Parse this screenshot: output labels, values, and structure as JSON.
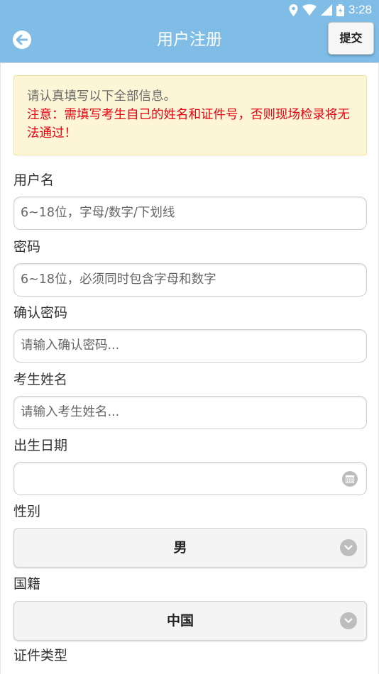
{
  "status_bar": {
    "time": "3:28"
  },
  "header": {
    "title": "用户注册",
    "submit_label": "提交"
  },
  "notice": {
    "line1": "请认真填写以下全部信息。",
    "line2": "注意：需填写考生自己的姓名和证件号，否则现场检录将无法通过！"
  },
  "form": {
    "username": {
      "label": "用户名",
      "placeholder": "6~18位，字母/数字/下划线"
    },
    "password": {
      "label": "密码",
      "placeholder": "6~18位，必须同时包含字母和数字"
    },
    "confirm_password": {
      "label": "确认密码",
      "placeholder": "请输入确认密码..."
    },
    "student_name": {
      "label": "考生姓名",
      "placeholder": "请输入考生姓名..."
    },
    "birth_date": {
      "label": "出生日期",
      "value": ""
    },
    "gender": {
      "label": "性别",
      "selected": "男"
    },
    "nationality": {
      "label": "国籍",
      "selected": "中国"
    },
    "id_type": {
      "label": "证件类型"
    }
  },
  "colors": {
    "header_bg": "#7fbde7",
    "notice_bg": "#fcf6d6",
    "warning": "#e60012"
  }
}
